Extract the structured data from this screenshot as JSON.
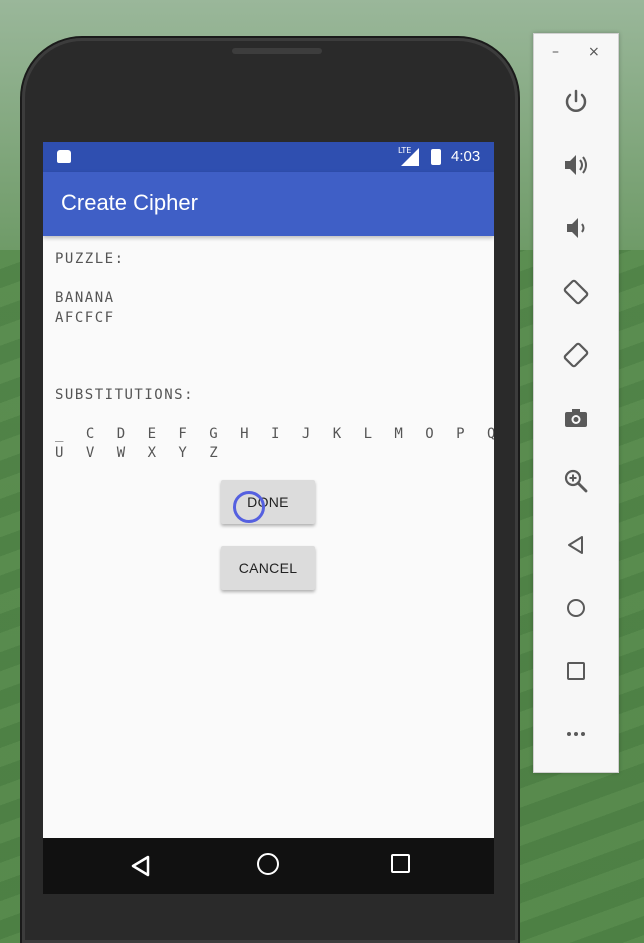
{
  "app": {
    "title": "Create Cipher"
  },
  "status_bar": {
    "time": "4:03",
    "network": "LTE"
  },
  "content": {
    "puzzle_label": "PUZZLE:",
    "puzzle_line1": "BANANA",
    "puzzle_line2": "AFCFCF",
    "substitutions_label": "SUBSTITUTIONS:",
    "substitutions_row1": "_ C D E F G H I J K L M O P Q R S T",
    "substitutions_row2": "U V W X Y Z"
  },
  "buttons": {
    "done_label": "DONE",
    "cancel_label": "CANCEL"
  },
  "emulator_panel": {
    "minimize": "–",
    "close": "×",
    "icons": [
      "power-icon",
      "volume-up-icon",
      "volume-down-icon",
      "rotate-left-icon",
      "rotate-right-icon",
      "camera-icon",
      "zoom-icon",
      "back-icon",
      "home-icon",
      "overview-icon",
      "more-icon"
    ]
  },
  "colors": {
    "status_bar": "#2f4fb0",
    "app_bar": "#3f5fc6",
    "button": "#dcdcdc"
  }
}
